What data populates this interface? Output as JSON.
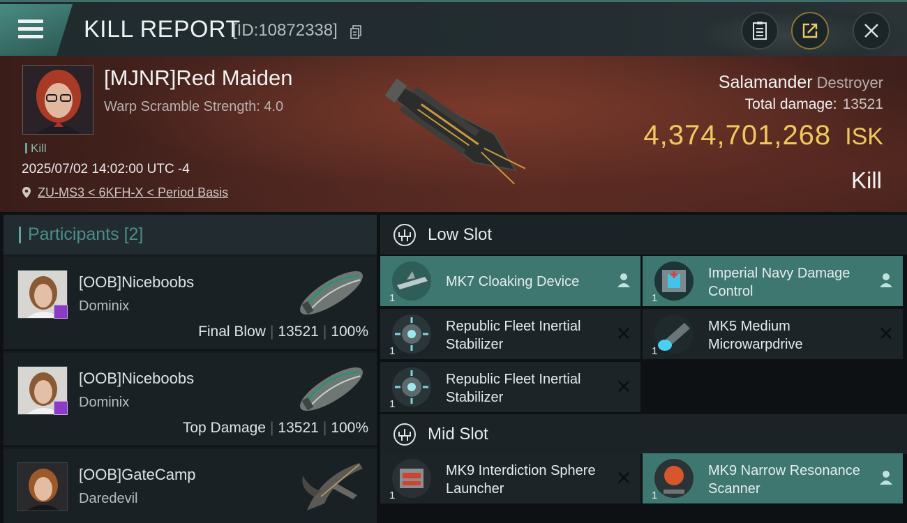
{
  "header": {
    "title": "KILL REPORT",
    "report_id": "[ID:10872338]"
  },
  "victim": {
    "name": "[MJNR]Red Maiden",
    "scramble": "Warp Scramble Strength: 4.0",
    "tag": "Kill",
    "time": "2025/07/02 14:02:00 UTC -4",
    "location": "ZU-MS3 < 6KFH-X < Period Basis",
    "ship": "Salamander",
    "ship_class": "Destroyer",
    "total_damage_label": "Total damage:",
    "total_damage": "13521",
    "isk_value": "4,374,701,268",
    "isk_unit": "ISK",
    "result": "Kill"
  },
  "participants": {
    "label": "Participants",
    "count": "[2]",
    "rows": [
      {
        "name": "[OOB]Niceboobs",
        "ship": "Dominix",
        "role": "Final Blow",
        "damage": "13521",
        "percent": "100%"
      },
      {
        "name": "[OOB]Niceboobs",
        "ship": "Dominix",
        "role": "Top Damage",
        "damage": "13521",
        "percent": "100%"
      },
      {
        "name": "[OOB]GateCamp",
        "ship": "Daredevil"
      }
    ]
  },
  "slots": {
    "low": {
      "title": "Low Slot",
      "modules": [
        {
          "name": "MK7 Cloaking Device",
          "qty": "1",
          "status": "dropped"
        },
        {
          "name": "Imperial Navy Damage Control",
          "qty": "1",
          "status": "dropped"
        },
        {
          "name": "Republic Fleet Inertial Stabilizer",
          "qty": "1",
          "status": "destroyed"
        },
        {
          "name": "MK5 Medium Microwarpdrive",
          "qty": "1",
          "status": "destroyed"
        },
        {
          "name": "Republic Fleet Inertial Stabilizer",
          "qty": "1",
          "status": "destroyed"
        }
      ]
    },
    "mid": {
      "title": "Mid Slot",
      "modules": [
        {
          "name": "MK9 Interdiction Sphere Launcher",
          "qty": "1",
          "status": "destroyed"
        },
        {
          "name": "MK9 Narrow Resonance Scanner",
          "qty": "1",
          "status": "dropped"
        }
      ]
    }
  },
  "colors": {
    "accent": "#3d7770",
    "isk": "#f1c860",
    "banner": "#4c2620"
  },
  "icons": [
    "menu-icon",
    "copy-icon",
    "clipboard-icon",
    "export-icon",
    "close-icon",
    "pin-icon",
    "slot-icon",
    "person-icon",
    "x-icon"
  ]
}
